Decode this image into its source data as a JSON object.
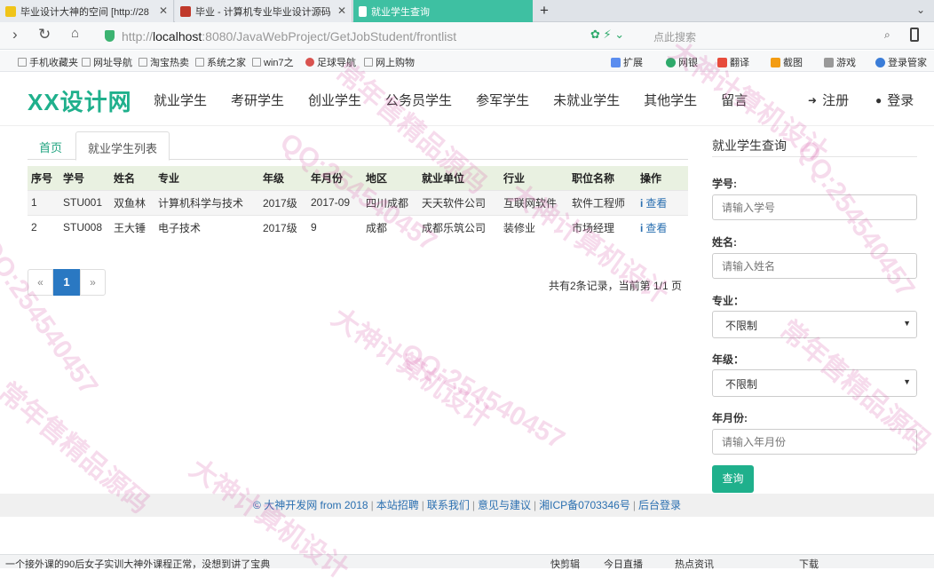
{
  "browser": {
    "tabs": [
      {
        "title": "毕业设计大神的空间 [http://28",
        "active": false
      },
      {
        "title": "毕业 - 计算机专业毕业设计源码",
        "active": false
      },
      {
        "title": "就业学生查询",
        "active": true
      }
    ],
    "new_tab_label": "+",
    "url_prefix": "http://",
    "url_host": "localhost",
    "url_rest": ":8080/JavaWebProject/GetJobStudent/frontlist",
    "search_placeholder": "点此搜索",
    "bookmarks_left": [
      "手机收藏夹",
      "网址导航",
      "淘宝热卖",
      "系统之家",
      "win7之",
      "足球导航",
      "网上购物"
    ],
    "bookmarks_right": [
      "扩展",
      "网银",
      "翻译",
      "截图",
      "游戏",
      "登录管家"
    ]
  },
  "site": {
    "brand": "XX设计网",
    "nav": [
      "就业学生",
      "考研学生",
      "创业学生",
      "公务员学生",
      "参军学生",
      "未就业学生",
      "其他学生",
      "留言"
    ],
    "register": "注册",
    "login": "登录"
  },
  "main": {
    "tabs": [
      "首页",
      "就业学生列表"
    ],
    "columns": [
      "序号",
      "学号",
      "姓名",
      "专业",
      "年级",
      "年月份",
      "地区",
      "就业单位",
      "行业",
      "职位名称",
      "操作"
    ],
    "rows": [
      {
        "no": "1",
        "sid": "STU001",
        "name": "双鱼林",
        "major": "计算机科学与技术",
        "grade": "2017级",
        "month": "2017-09",
        "region": "四川成都",
        "company": "天天软件公司",
        "industry": "互联网软件",
        "position": "软件工程师",
        "action": "查看"
      },
      {
        "no": "2",
        "sid": "STU008",
        "name": "王大锤",
        "major": "电子技术",
        "grade": "2017级",
        "month": "9",
        "region": "成都",
        "company": "成都乐筑公司",
        "industry": "装修业",
        "position": "市场经理",
        "action": "查看"
      }
    ],
    "pager": {
      "prev": "«",
      "current": "1",
      "next": "»"
    },
    "page_info": "共有2条记录，当前第 1/1 页"
  },
  "search": {
    "title": "就业学生查询",
    "fields": [
      {
        "label": "学号:",
        "placeholder": "请输入学号"
      },
      {
        "label": "姓名:",
        "placeholder": "请输入姓名"
      },
      {
        "label": "专业：",
        "value": "不限制"
      },
      {
        "label": "年级：",
        "value": "不限制"
      },
      {
        "label": "年月份:",
        "placeholder": "请输入年月份"
      }
    ],
    "submit": "查询"
  },
  "footer": {
    "links": [
      "© 大神开发网 from 2018",
      "本站招聘",
      "联系我们",
      "意见与建议",
      "湘ICP备0703346号",
      "后台登录"
    ]
  },
  "statusbar": {
    "news": "一个接外课的90后女子实训大神外课程正常，没想到讲了宝典",
    "items": [
      "快剪辑",
      "今日直播",
      "热点资讯",
      "下载"
    ]
  },
  "watermark": {
    "qq": "QQ:254540457",
    "god": "大神计算机设计",
    "shop": "常年售精品源码"
  },
  "colors": {
    "brand": "#1fb08c",
    "link": "#2a6fb0",
    "active_tab": "#3ec0a2",
    "table_header": "#e9f1e1"
  }
}
